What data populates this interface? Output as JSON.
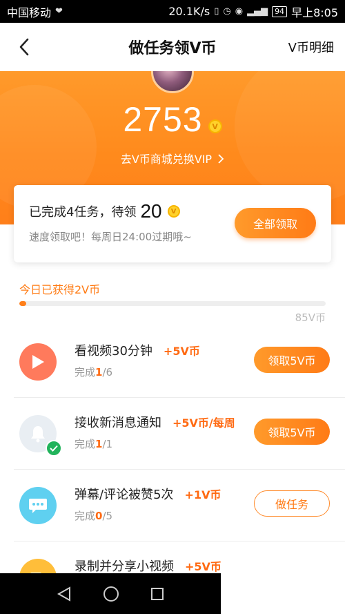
{
  "status_bar": {
    "carrier": "中国移动",
    "speed": "20.1K/s",
    "battery": "94",
    "time": "早上8:05"
  },
  "header": {
    "title": "做任务领V币",
    "right_link": "V币明细"
  },
  "banner": {
    "coin_balance": "2753",
    "coin_symbol": "V",
    "mall_link": "去V币商城兑换VIP"
  },
  "summary": {
    "text": "已完成4任务，待领",
    "pending_amount": "20",
    "coin_symbol": "V",
    "subtitle": "速度领取吧！每周日24:00过期哦~",
    "claim_all_label": "全部领取"
  },
  "progress": {
    "today_label": "今日已获得2V币",
    "max_label": "85V币",
    "earned": 2,
    "max": 85
  },
  "tasks": [
    {
      "icon": "play-icon",
      "title": "看视频30分钟",
      "reward": "+5V币",
      "progress_prefix": "完成",
      "done": "1",
      "total": "/6",
      "button": "领取5V币",
      "button_style": "filled"
    },
    {
      "icon": "bell-icon",
      "title": "接收新消息通知",
      "reward": "+5V币/每周",
      "progress_prefix": "完成",
      "done": "1",
      "total": "/1",
      "button": "领取5V币",
      "button_style": "filled"
    },
    {
      "icon": "chat-bubble-icon",
      "title": "弹幕/评论被赞5次",
      "reward": "+1V币",
      "progress_prefix": "完成",
      "done": "0",
      "total": "/5",
      "button": "做任务",
      "button_style": "outline"
    },
    {
      "icon": "video-record-icon",
      "title": "录制并分享小视频",
      "reward": "+5V币"
    }
  ],
  "colors": {
    "accent": "#ff7f1a",
    "reward": "#ff6a12",
    "check": "#21b35b",
    "play_bg": "#ff7a5c",
    "chat_bg": "#5fd0f0",
    "bell_bg": "#e9eef3",
    "record_bg": "#ffbe3a"
  }
}
